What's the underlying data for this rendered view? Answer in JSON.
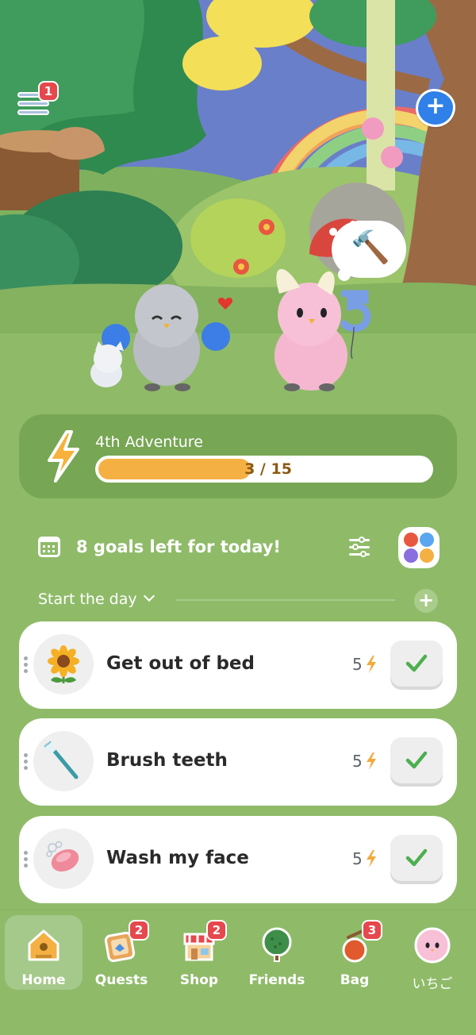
{
  "topbar": {
    "menu_badge": "1"
  },
  "scene": {
    "tool_bubble_icon": "🔨"
  },
  "adventure": {
    "title": "4th Adventure",
    "progress_current": 3,
    "progress_total": 15,
    "progress_text": "3 / 15"
  },
  "goals": {
    "title": "8 goals left for today!"
  },
  "section": {
    "title": "Start the day"
  },
  "habits": [
    {
      "name": "Get out of bed",
      "points": "5",
      "icon": "sunflower-icon"
    },
    {
      "name": "Brush teeth",
      "points": "5",
      "icon": "toothbrush-icon"
    },
    {
      "name": "Wash my face",
      "points": "5",
      "icon": "soap-icon"
    }
  ],
  "tabs": [
    {
      "label": "Home",
      "icon": "home-icon",
      "badge": "",
      "active": true
    },
    {
      "label": "Quests",
      "icon": "quests-icon",
      "badge": "2"
    },
    {
      "label": "Shop",
      "icon": "shop-icon",
      "badge": "2"
    },
    {
      "label": "Friends",
      "icon": "tree-icon",
      "badge": ""
    },
    {
      "label": "Bag",
      "icon": "bag-icon",
      "badge": "3"
    },
    {
      "label": "いちご",
      "icon": "avatar-icon",
      "badge": ""
    }
  ],
  "colors": {
    "grass": "#8fbb69",
    "card_dark": "#77a654",
    "progress": "#f5b044",
    "check": "#4caf50",
    "badge": "#e5484d",
    "accent_blue": "#2f80e8"
  }
}
